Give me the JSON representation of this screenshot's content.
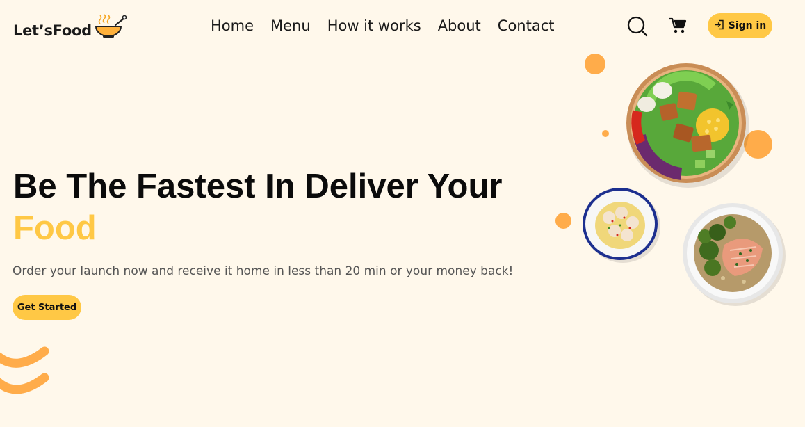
{
  "brand": {
    "name": "Let’sFood",
    "logo_icon": "soup-bowl-icon"
  },
  "nav": {
    "items": [
      {
        "label": "Home"
      },
      {
        "label": "Menu"
      },
      {
        "label": "How it works"
      },
      {
        "label": "About"
      },
      {
        "label": "Contact"
      }
    ]
  },
  "header": {
    "search_icon": "search-icon",
    "cart_icon": "cart-icon",
    "signin_label": "Sign in",
    "signin_icon": "sign-in-icon"
  },
  "hero": {
    "headline_line1": "Be The Fastest In Deliver Your",
    "headline_accent": "Food",
    "subtitle": "Order your launch now and receive it home in less than 20 min or your money back!",
    "cta_label": "Get Started",
    "images": [
      "salad-bowl-image",
      "ceviche-bowl-image",
      "salmon-broccoli-plate-image"
    ]
  },
  "colors": {
    "background": "#fff8eb",
    "accent": "#ffc845",
    "orange_dot": "#ffac4a",
    "text": "#0b0b0b",
    "muted": "#555555"
  }
}
